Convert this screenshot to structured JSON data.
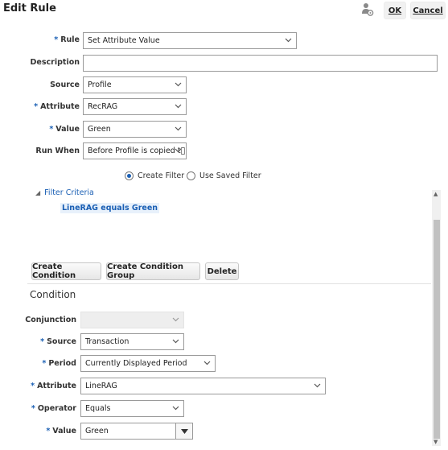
{
  "dialog": {
    "title": "Edit Rule",
    "ok_label": "OK",
    "cancel_label": "Cancel"
  },
  "rule_form": {
    "rule_label": "Rule",
    "rule_value": "Set Attribute Value",
    "description_label": "Description",
    "description_value": "",
    "source_label": "Source",
    "source_value": "Profile",
    "attribute_label": "Attribute",
    "attribute_value": "RecRAG",
    "value_label": "Value",
    "value_value": "Green",
    "run_when_label": "Run When",
    "run_when_value": "Before Profile is copied t\u0000"
  },
  "filter_options": {
    "create_filter": "Create Filter",
    "use_saved_filter": "Use Saved Filter",
    "selected": "create_filter"
  },
  "filter_criteria": {
    "label": "Filter Criteria",
    "items": [
      "LineRAG equals Green"
    ]
  },
  "condition_buttons": {
    "create_condition": "Create Condition",
    "create_condition_group": "Create Condition Group",
    "delete": "Delete"
  },
  "condition": {
    "title": "Condition",
    "conjunction_label": "Conjunction",
    "conjunction_value": "",
    "source_label": "Source",
    "source_value": "Transaction",
    "period_label": "Period",
    "period_value": "Currently Displayed Period",
    "attribute_label": "Attribute",
    "attribute_value": "LineRAG",
    "operator_label": "Operator",
    "operator_value": "Equals",
    "value_label": "Value",
    "value_value": "Green"
  },
  "icons": {
    "header_icon": "user-settings-icon",
    "chevron": "chevron-down-icon"
  },
  "colors": {
    "accent": "#1a5fb4",
    "required": "#1a5fb4"
  }
}
